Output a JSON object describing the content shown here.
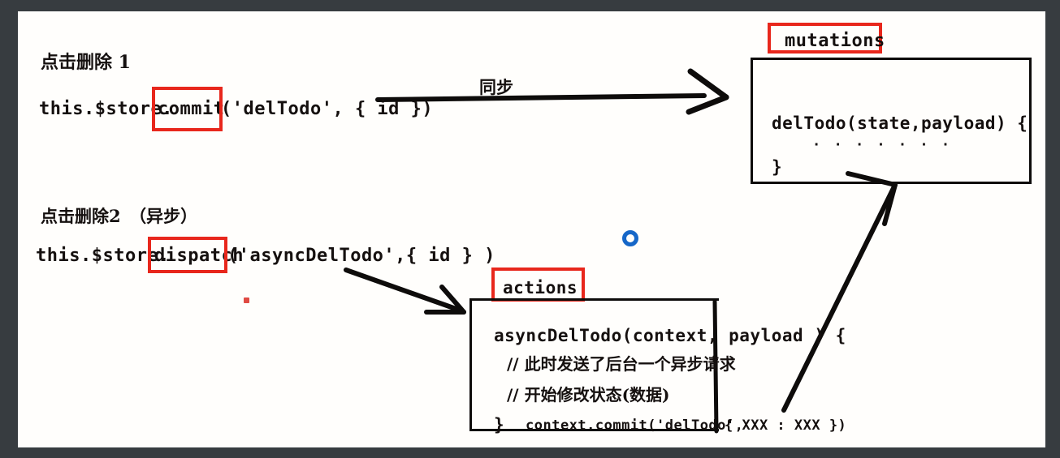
{
  "frame": {
    "border_color": "#373c40",
    "canvas_color": "#fffefc"
  },
  "colors": {
    "ink": "#15100f",
    "highlight_red": "#e8271c",
    "marker_blue": "#1667c8",
    "dot_red": "#e04a43"
  },
  "annotations": {
    "step1_label": "点击删除 1",
    "step2_label": "点击删除2　（异步）",
    "sync_label": "同步"
  },
  "code_lines": {
    "commit_prefix": "this.$store.",
    "commit_keyword": "commit",
    "commit_suffix": "('delTodo', { id })",
    "dispatch_prefix": "this.$store.",
    "dispatch_keyword": "dispatch",
    "dispatch_suffix": "('asyncDelTodo',{ id } )"
  },
  "mutations_box": {
    "title": "mutations",
    "lines": [
      "delTodo(state,payload) {",
      "· · · · · · ·",
      "}"
    ]
  },
  "actions_box": {
    "title": "actions",
    "lines": [
      "asyncDelTodo(context, payload ) {",
      "// 此时发送了后台一个异步请求",
      "// 开始修改状态(数据)",
      "}",
      "context.commit('delTodo',",
      "{ XXX : XXX })"
    ]
  },
  "markers": {
    "blue_ring": "loading-ring-marker",
    "red_dot": "red-dot-marker"
  }
}
